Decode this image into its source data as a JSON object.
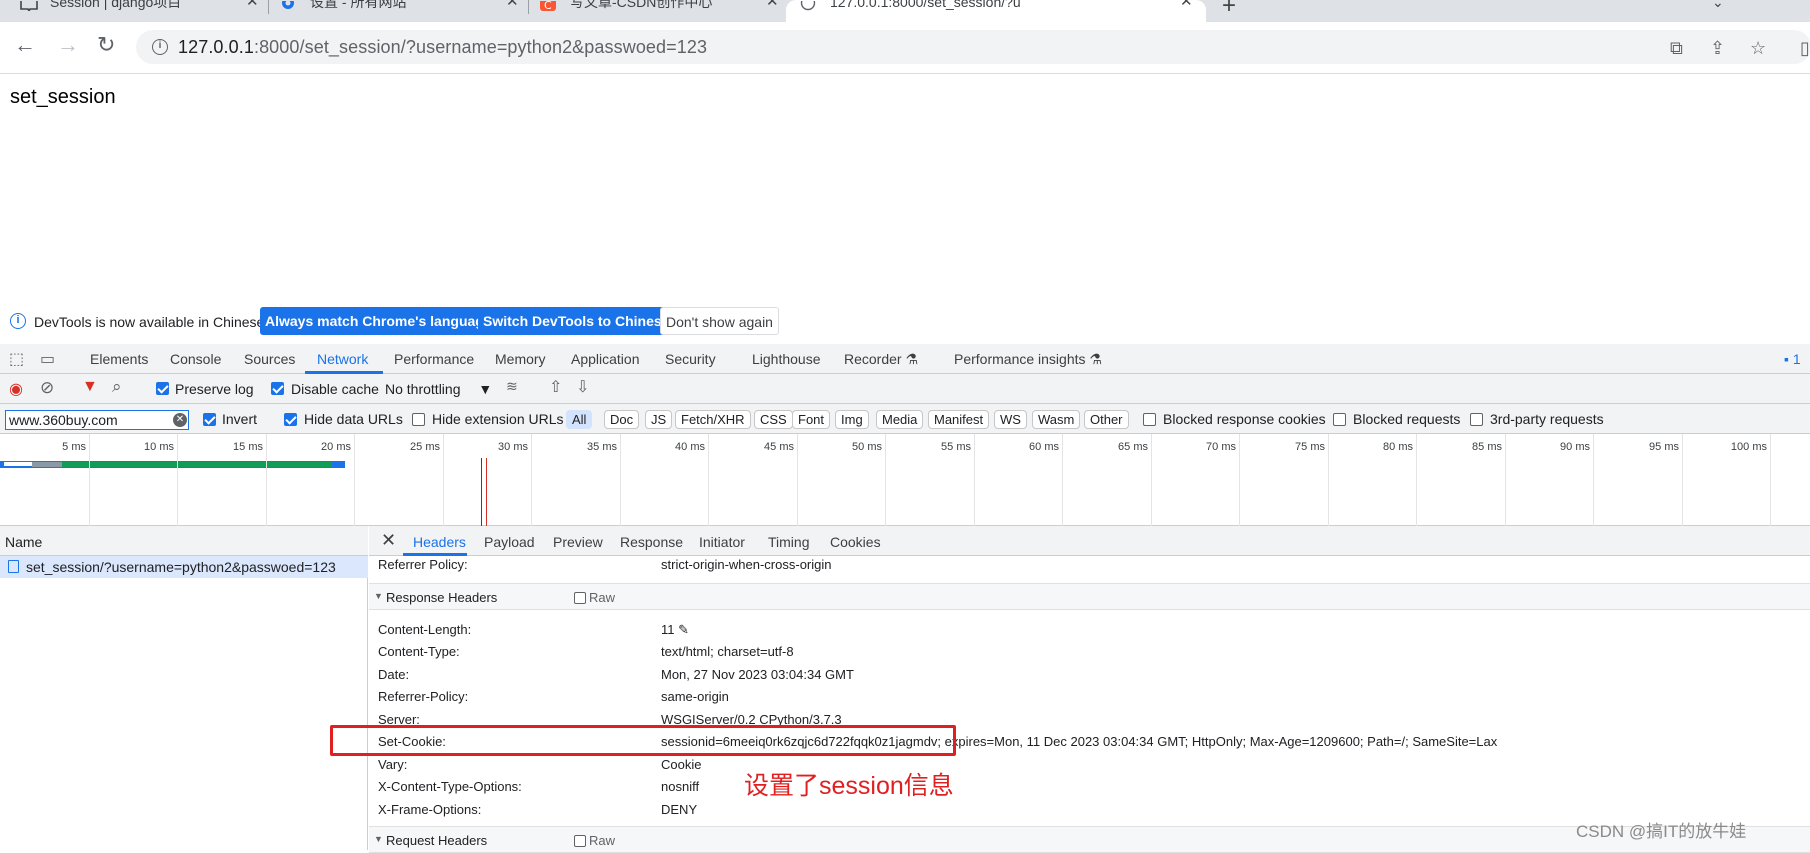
{
  "browser": {
    "tabs": [
      {
        "title": "Session | django项目",
        "close": "✕"
      },
      {
        "title": "设置 - 所有网站",
        "close": "✕"
      },
      {
        "title": "写文章-CSDN创作中心",
        "close": "✕"
      },
      {
        "title": "127.0.0.1:8000/set_session/?u",
        "close": "✕"
      }
    ],
    "new_tab": "+",
    "url_host": "127.0.0.1",
    "url_rest": ":8000/set_session/?username=python2&passwoed=123"
  },
  "page": {
    "text": "set_session"
  },
  "devtools": {
    "infobar": {
      "message": "DevTools is now available in Chinese!",
      "btn_match": "Always match Chrome's language",
      "btn_switch": "Switch DevTools to Chinese",
      "btn_dismiss": "Don't show again"
    },
    "panels": [
      "Elements",
      "Console",
      "Sources",
      "Network",
      "Performance",
      "Memory",
      "Application",
      "Security",
      "Lighthouse",
      "Recorder",
      "Performance insights"
    ],
    "issues_count": "1",
    "toolbar": {
      "preserve_log": "Preserve log",
      "disable_cache": "Disable cache",
      "throttling": "No throttling"
    },
    "filter": {
      "value": "www.360buy.com",
      "invert": "Invert",
      "hide_data_urls": "Hide data URLs",
      "hide_extension_urls": "Hide extension URLs",
      "types": [
        "All",
        "Doc",
        "JS",
        "Fetch/XHR",
        "CSS",
        "Font",
        "Img",
        "Media",
        "Manifest",
        "WS",
        "Wasm",
        "Other"
      ],
      "blocked_cookies": "Blocked response cookies",
      "blocked_requests": "Blocked requests",
      "third_party": "3rd-party requests"
    },
    "timeline_labels": [
      "5 ms",
      "10 ms",
      "15 ms",
      "20 ms",
      "25 ms",
      "30 ms",
      "35 ms",
      "40 ms",
      "45 ms",
      "50 ms",
      "55 ms",
      "60 ms",
      "65 ms",
      "70 ms",
      "75 ms",
      "80 ms",
      "85 ms",
      "90 ms",
      "95 ms",
      "100 ms"
    ],
    "requests": {
      "column": "Name",
      "rows": [
        "set_session/?username=python2&passwoed=123"
      ]
    },
    "detail_tabs": [
      "Headers",
      "Payload",
      "Preview",
      "Response",
      "Initiator",
      "Timing",
      "Cookies"
    ],
    "referrer_policy": {
      "name": "Referrer Policy:",
      "value": "strict-origin-when-cross-origin"
    },
    "response_headers_title": "Response Headers",
    "raw_label": "Raw",
    "response_headers": [
      {
        "name": "Content-Length:",
        "value": "11"
      },
      {
        "name": "Content-Type:",
        "value": "text/html; charset=utf-8"
      },
      {
        "name": "Date:",
        "value": "Mon, 27 Nov 2023 03:04:34 GMT"
      },
      {
        "name": "Referrer-Policy:",
        "value": "same-origin"
      },
      {
        "name": "Server:",
        "value": "WSGIServer/0.2 CPython/3.7.3"
      },
      {
        "name": "Set-Cookie:",
        "value": "sessionid=6meeiq0rk6zqjc6d722fqqk0z1jagmdv; expires=Mon, 11 Dec 2023 03:04:34 GMT; HttpOnly; Max-Age=1209600; Path=/; SameSite=Lax"
      },
      {
        "name": "Vary:",
        "value": "Cookie"
      },
      {
        "name": "X-Content-Type-Options:",
        "value": "nosniff"
      },
      {
        "name": "X-Frame-Options:",
        "value": "DENY"
      }
    ],
    "request_headers_title": "Request Headers"
  },
  "annotation": {
    "text": "设置了session信息",
    "color": "#e02020"
  },
  "watermark": "CSDN @搞IT的放牛娃",
  "colors": {
    "accent": "#1a73e8",
    "annotation_red": "#e02020"
  }
}
